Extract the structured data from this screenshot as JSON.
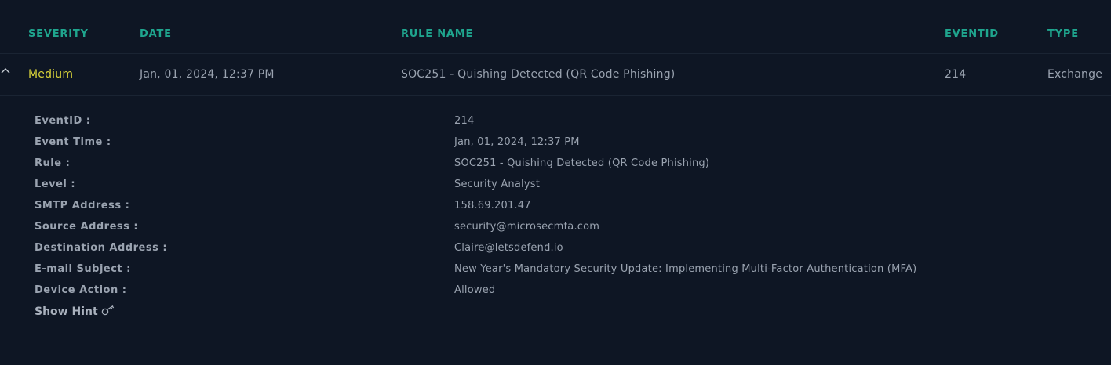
{
  "table": {
    "headers": {
      "severity": "SEVERITY",
      "date": "DATE",
      "rule_name": "RULE NAME",
      "event_id": "EVENTID",
      "type": "TYPE"
    },
    "row": {
      "severity": "Medium",
      "date": "Jan, 01, 2024, 12:37 PM",
      "rule_name": "SOC251 - Quishing Detected (QR Code Phishing)",
      "event_id": "214",
      "type": "Exchange"
    }
  },
  "details": [
    {
      "label": "EventID :",
      "value": "214"
    },
    {
      "label": "Event Time :",
      "value": "Jan, 01, 2024, 12:37 PM"
    },
    {
      "label": "Rule :",
      "value": "SOC251 - Quishing Detected (QR Code Phishing)"
    },
    {
      "label": "Level :",
      "value": "Security Analyst"
    },
    {
      "label": "SMTP Address :",
      "value": "158.69.201.47"
    },
    {
      "label": "Source Address :",
      "value": "security@microsecmfa.com"
    },
    {
      "label": "Destination Address :",
      "value": "Claire@letsdefend.io"
    },
    {
      "label": "E-mail Subject :",
      "value": "New Year's Mandatory Security Update: Implementing Multi-Factor Authentication (MFA)"
    },
    {
      "label": "Device Action :",
      "value": "Allowed"
    }
  ],
  "hint": {
    "label": "Show Hint",
    "icon": "key-icon"
  },
  "colors": {
    "background": "#0e1624",
    "header_accent": "#1fa58e",
    "severity_medium": "#d9d33a",
    "text": "#9aa3b0"
  }
}
